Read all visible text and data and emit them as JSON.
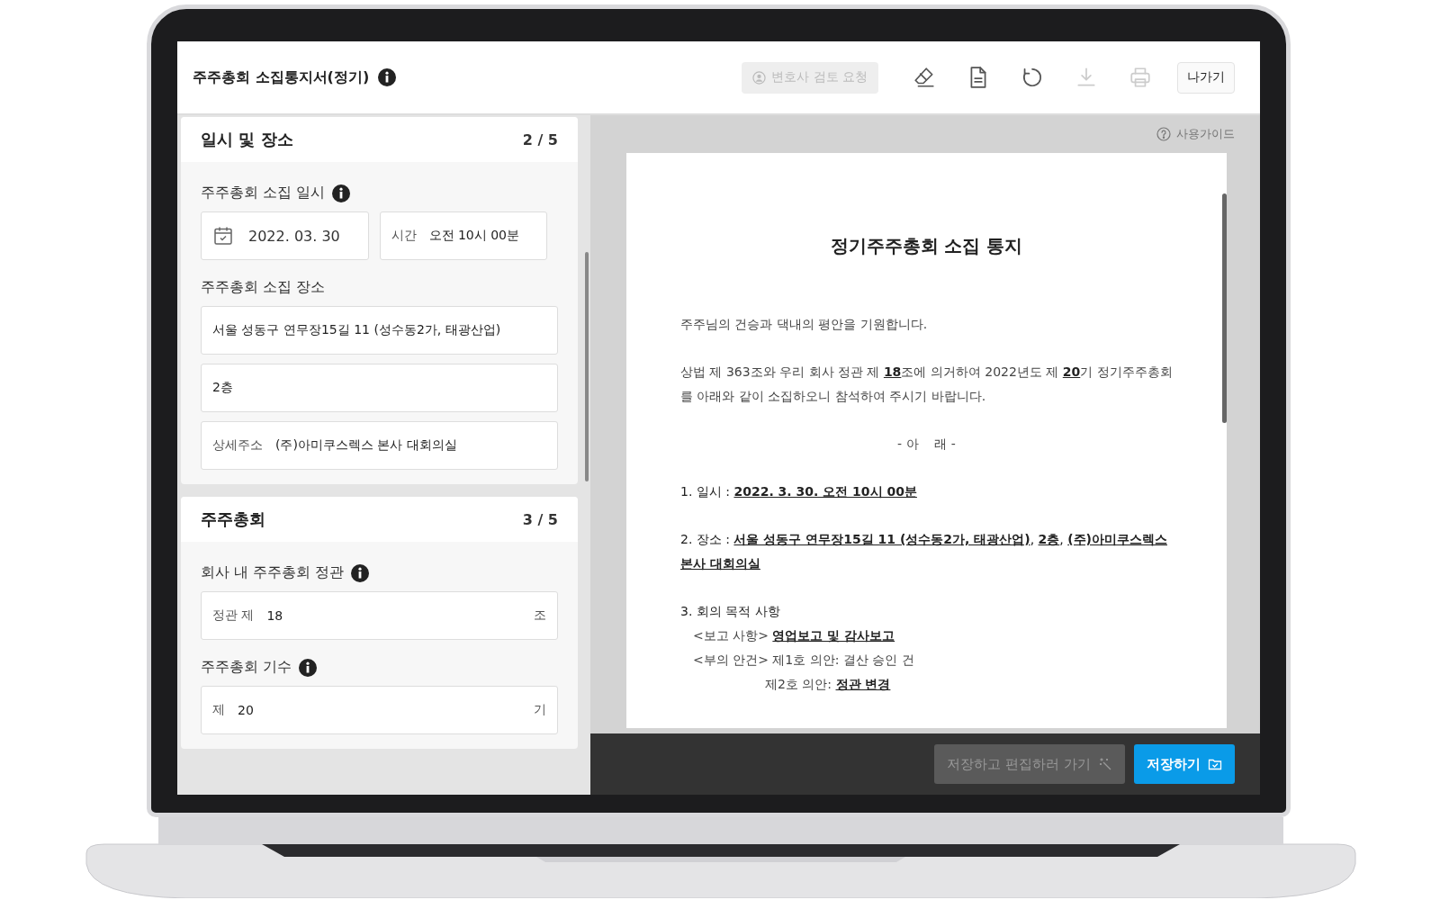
{
  "header": {
    "title": "주주총회 소집통지서(정기)",
    "review_button": {
      "label": "변호사 검토 요청",
      "disabled": true
    },
    "tools": [
      {
        "kind": "eraser",
        "disabled": false
      },
      {
        "kind": "document",
        "disabled": false
      },
      {
        "kind": "refresh",
        "disabled": false
      },
      {
        "kind": "download",
        "disabled": true
      },
      {
        "kind": "print",
        "disabled": true
      }
    ],
    "exit_button": "나가기"
  },
  "sections": [
    {
      "title": "일시 및 장소",
      "step": "2 / 5",
      "rows": [
        {
          "kind": "label",
          "text": "주주총회 소집 일시",
          "info": true
        },
        {
          "kind": "inputs",
          "inputs": [
            {
              "kind": "date",
              "value": "2022. 03. 30"
            },
            {
              "kind": "text",
              "prefix": "시간",
              "value": "오전 10시 00분"
            }
          ]
        },
        {
          "kind": "label",
          "text": "주주총회 소집 장소",
          "info": false
        },
        {
          "kind": "inputs",
          "inputs": [
            {
              "kind": "text",
              "value": "서울 성동구 연무장15길 11 (성수동2가, 태광산업)"
            }
          ]
        },
        {
          "kind": "inputs",
          "inputs": [
            {
              "kind": "text",
              "value": "2층"
            }
          ]
        },
        {
          "kind": "inputs",
          "inputs": [
            {
              "kind": "text",
              "prefix": "상세주소",
              "value": "(주)아미쿠스렉스 본사 대회의실"
            }
          ]
        }
      ]
    },
    {
      "title": "주주총회",
      "step": "3 / 5",
      "rows": [
        {
          "kind": "label",
          "text": "회사 내 주주총회 정관",
          "info": true
        },
        {
          "kind": "inputs",
          "inputs": [
            {
              "kind": "text",
              "prefix": "정관 제",
              "value": "18",
              "suffix": "조"
            }
          ]
        },
        {
          "kind": "label",
          "text": "주주총회 기수",
          "info": true
        },
        {
          "kind": "inputs",
          "inputs": [
            {
              "kind": "text",
              "prefix": "제",
              "value": "20",
              "suffix": "기"
            }
          ]
        }
      ]
    }
  ],
  "preview": {
    "guide_link": "사용가이드",
    "document": {
      "title": "정기주주총회 소집 통지",
      "lines": [
        {
          "kind": "para",
          "text": "주주님의 건승과 댁내의 평안을 기원합니다."
        },
        {
          "kind": "para",
          "text": "상법 제 363조와 우리 회사 정관 제 **18**조에 의거하여 2022년도 제 **20**기 정기주주총회를 아래와 같이 소집하오니 참석하여 주시기 바랍니다."
        },
        {
          "kind": "center",
          "text": "- 아    래 -"
        },
        {
          "kind": "item",
          "text": "1. 일시 : **2022. 3. 30. 오전 10시 00분**"
        },
        {
          "kind": "item",
          "text": "2. 장소 : **서울 성동구 연무장15길 11 (성수동2가, 태광산업)**, **2층**, **(주)아미쿠스렉스 본사 대회의실**"
        },
        {
          "kind": "heading",
          "text": "3. 회의 목적 사항"
        },
        {
          "kind": "sub",
          "text": "<보고 사항> **영업보고 및 감사보고**"
        },
        {
          "kind": "sub",
          "text": "<부의 안건> 제1호 의안: 결산 승인 건"
        },
        {
          "kind": "cont",
          "text": "제2호 의안: **정관 변경**"
        }
      ]
    }
  },
  "footer_buttons": [
    {
      "label": "저장하고 편집하러 가기",
      "kind": "secondary",
      "disabled": true
    },
    {
      "label": "저장하기",
      "kind": "primary",
      "disabled": false
    }
  ]
}
